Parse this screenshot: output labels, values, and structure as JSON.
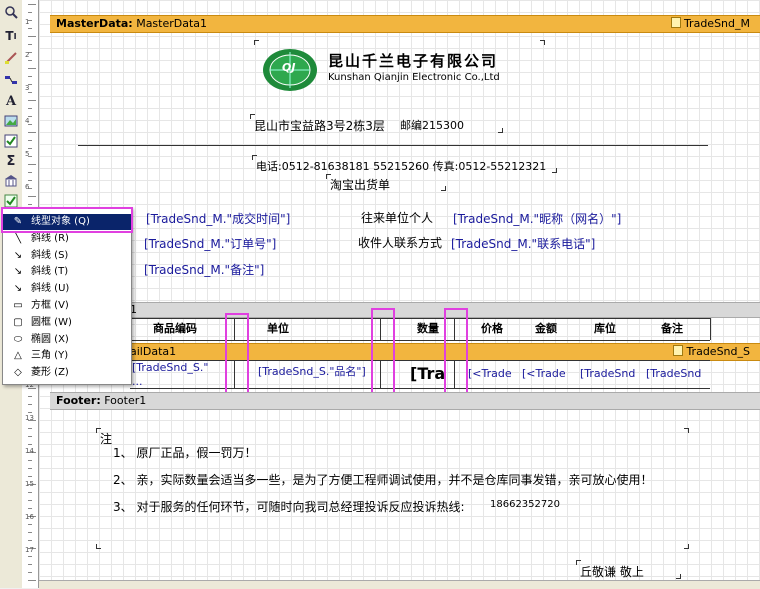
{
  "toolbar": {
    "icons": [
      "magnifier-icon",
      "text-icon",
      "paint-icon",
      "link-icon",
      "font-icon",
      "picture-icon",
      "checkbox-icon",
      "sum-icon",
      "building-icon",
      "check-icon",
      "shape-icon"
    ]
  },
  "ruler": {
    "numbers": [
      "1",
      "2",
      "3",
      "4",
      "5",
      "6",
      "7",
      "8",
      "9",
      "10",
      "11",
      "12",
      "13",
      "14",
      "15",
      "16",
      "17"
    ]
  },
  "master": {
    "band_type": "MasterData:",
    "band_name": "MasterData1",
    "band_source": "TradeSnd_M",
    "company_cn": "昆山千兰电子有限公司",
    "company_en": "Kunshan Qianjin Electronic Co.,Ltd",
    "logo_text": "QJ",
    "address": "昆山市宝益路3号2栋3层",
    "postcode": "邮编215300",
    "phone": "电话:0512-81638181 55215260 传真:0512-55212321",
    "doc_title": "淘宝出货单",
    "f_time": "[TradeSnd_M.\"成交时间\"]",
    "f_order": "[TradeSnd_M.\"订单号\"]",
    "f_note": "[TradeSnd_M.\"备注\"]",
    "lbl_customer": "往来单位个人",
    "f_nick": "[TradeSnd_M.\"昵称（网名）\"]",
    "lbl_contact": "收件人联系方式",
    "f_tel": "[TradeSnd_M.\"联系电话\"]"
  },
  "table_header": {
    "band_num": "1",
    "cols": [
      "商品编码",
      "单位",
      "数量",
      "价格",
      "金额",
      "库位",
      "备注"
    ]
  },
  "detail": {
    "band_name": "ailData1",
    "band_source": "TradeSnd_S",
    "f_code": "[TradeSnd_S.\"",
    "f_code2": "...",
    "f_name": "[TradeSnd_S.\"品名\"]",
    "f_qty": "[Tra",
    "f_price": "[<Trade",
    "f_amount": "[<Trade",
    "f_loc": "[TradeSnd",
    "f_memo": "[TradeSnd"
  },
  "footer": {
    "band_type": "Footer:",
    "band_name": "Footer1",
    "note_title": "注",
    "line1": "1、 原厂正品，假一罚万！",
    "line2": "2、 亲，实际数量会适当多一些，是为了方便工程师调试使用，并不是仓库同事发错，亲可放心使用！",
    "line3": "3、 对于服务的任何环节，可随时向我司总经理投诉反应投诉热线:",
    "hotline": "18662352720",
    "sign": "丘敬谦 敬上"
  },
  "menu": {
    "items": [
      {
        "label": "线型对象 (Q)",
        "icon": "pencil-icon",
        "selected": true
      },
      {
        "label": "斜线 (R)",
        "icon": "diagonal-line-icon"
      },
      {
        "label": "斜线 (S)",
        "icon": "diagonal-arrow-icon"
      },
      {
        "label": "斜线 (T)",
        "icon": "diagonal-arrow-icon"
      },
      {
        "label": "斜线 (U)",
        "icon": "diagonal-arrow-icon"
      },
      {
        "label": "方框 (V)",
        "icon": "rectangle-icon"
      },
      {
        "label": "圆框 (W)",
        "icon": "rounded-rect-icon"
      },
      {
        "label": "椭圆 (X)",
        "icon": "ellipse-icon"
      },
      {
        "label": "三角 (Y)",
        "icon": "triangle-icon"
      },
      {
        "label": "菱形 (Z)",
        "icon": "diamond-icon"
      }
    ]
  },
  "colors": {
    "band": "#f2b53f",
    "highlight": "#e040e0",
    "menu_select": "#0a246a",
    "field": "#1a1a9c"
  }
}
